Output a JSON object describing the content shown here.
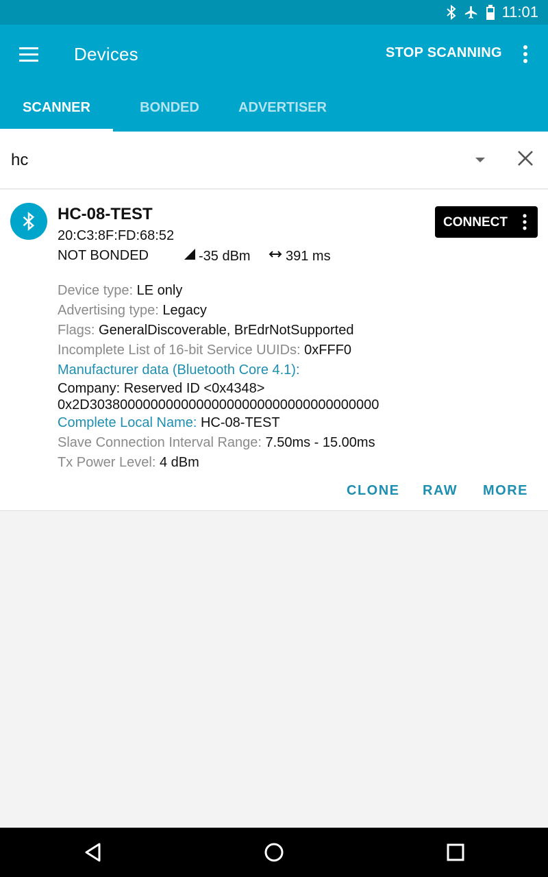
{
  "status_bar": {
    "time": "11:01",
    "icons": [
      "bluetooth-icon",
      "airplane-mode-icon",
      "battery-icon"
    ]
  },
  "app_bar": {
    "title": "Devices",
    "stop_scanning_label": "STOP SCANNING",
    "tabs": [
      {
        "label": "SCANNER",
        "active": true
      },
      {
        "label": "BONDED",
        "active": false
      },
      {
        "label": "ADVERTISER",
        "active": false
      }
    ]
  },
  "filter": {
    "value": "hc"
  },
  "device": {
    "name": "HC-08-TEST",
    "address": "20:C3:8F:FD:68:52",
    "bond_state": "NOT BONDED",
    "rssi": "-35 dBm",
    "interval": "391 ms",
    "connect_label": "CONNECT",
    "details": {
      "device_type_label": "Device type: ",
      "device_type_value": "LE only",
      "adv_type_label": "Advertising type: ",
      "adv_type_value": "Legacy",
      "flags_label": "Flags: ",
      "flags_value": "GeneralDiscoverable, BrEdrNotSupported",
      "uuids_label": "Incomplete List of 16-bit Service UUIDs: ",
      "uuids_value": "0xFFF0",
      "manufacturer_label": "Manufacturer data (Bluetooth Core 4.1):",
      "manufacturer_company": "Company: Reserved ID <0x4348>",
      "manufacturer_data": "0x2D30380000000000000000000000000000000000",
      "local_name_label": "Complete Local Name: ",
      "local_name_value": "HC-08-TEST",
      "slave_interval_label": "Slave Connection Interval Range: ",
      "slave_interval_value": "7.50ms - 15.00ms",
      "tx_power_label": "Tx Power Level: ",
      "tx_power_value": "4 dBm"
    },
    "actions": {
      "clone": "CLONE",
      "raw": "RAW",
      "more": "MORE"
    }
  },
  "colors": {
    "primary": "#00a5cc",
    "status_bar": "#0092b0",
    "accent_text": "#1e8fb0"
  }
}
